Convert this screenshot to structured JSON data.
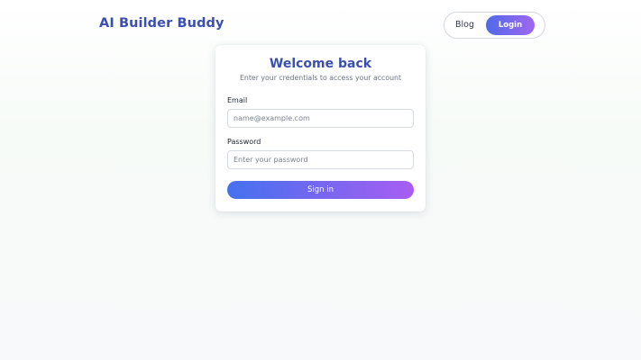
{
  "header": {
    "brand": "AI Builder Buddy",
    "nav": {
      "blog_label": "Blog",
      "login_label": "Login"
    }
  },
  "login_card": {
    "title": "Welcome back",
    "subtitle": "Enter your credentials to access your account",
    "email": {
      "label": "Email",
      "value": "",
      "placeholder": "name@example.com"
    },
    "password": {
      "label": "Password",
      "value": "",
      "placeholder": "Enter your password"
    },
    "submit_label": "Sign in"
  },
  "colors": {
    "brand": "#3a4fb0",
    "gradient_start": "#4471ef",
    "gradient_end": "#a85df2"
  }
}
